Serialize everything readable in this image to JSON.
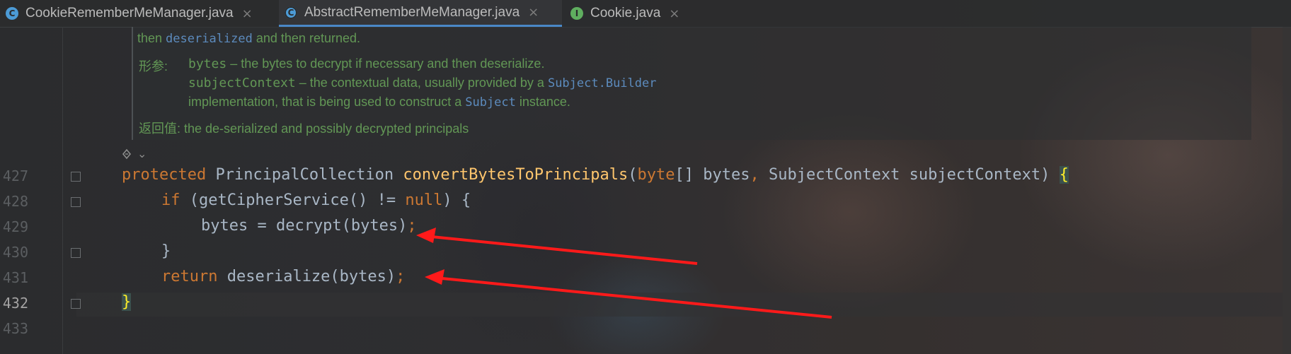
{
  "tabs": [
    {
      "icon": "C",
      "label": "CookieRememberMeManager.java",
      "close": "×",
      "active": false
    },
    {
      "icon": "C",
      "label": "AbstractRememberMeManager.java",
      "close": "×",
      "active": true
    },
    {
      "icon": "I",
      "label": "Cookie.java",
      "close": "×",
      "active": false
    }
  ],
  "doc": {
    "line1_pre": "then ",
    "line1_code": "deserialized",
    "line1_post": " and then returned.",
    "params_label": "形参:",
    "param1_name": "bytes",
    "param1_desc": " – the bytes to decrypt if necessary and then deserialize.",
    "param2_name": "subjectContext",
    "param2_desc": " – the contextual data, usually provided by a ",
    "param2_code": "Subject.Builder",
    "param2_cont_pre": "implementation, that is being used to construct a ",
    "param2_cont_code": "Subject",
    "param2_cont_post": " instance.",
    "returns_label": "返回值:",
    "returns_desc": " the de-serialized and possibly decrypted principals"
  },
  "lines": {
    "n427": "427",
    "n428": "428",
    "n429": "429",
    "n430": "430",
    "n431": "431",
    "n432": "432",
    "n433": "433"
  },
  "code": {
    "l427": {
      "kw": "protected",
      "type": " PrincipalCollection ",
      "fn": "convertBytesToPrincipals",
      "open": "(",
      "kw2": "byte",
      "arg1": "[] bytes",
      "comma": ",",
      "arg2": " SubjectContext subjectContext) ",
      "brace": "{"
    },
    "l428": {
      "kw": "if",
      "rest1": " (getCipherService() != ",
      "kw2": "null",
      "rest2": ") {"
    },
    "l429": {
      "text": "bytes = decrypt(bytes)",
      "semi": ";"
    },
    "l430": {
      "text": "}"
    },
    "l431": {
      "kw": "return",
      "text": " deserialize(bytes)",
      "semi": ";"
    },
    "l432": {
      "brace": "}"
    }
  },
  "icons": {
    "reader_mode": "reader-mode-icon",
    "chevron": "⌄"
  },
  "colors": {
    "background": "#2b2c2e",
    "keyword": "#cc7832",
    "function": "#ffc66d",
    "text": "#a9b7c6",
    "doc": "#629755",
    "doc_link": "#5c8bbd",
    "arrow": "#ff1a1a",
    "tab_accent": "#4a88c7"
  }
}
